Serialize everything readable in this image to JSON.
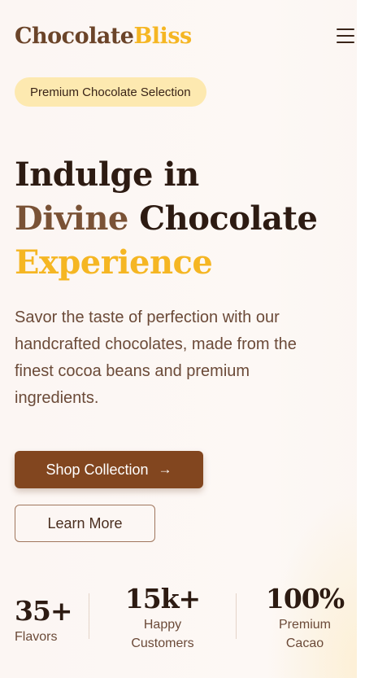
{
  "header": {
    "logo_part1": "Chocolate",
    "logo_part2": "Bliss",
    "menu_icon": "hamburger-menu-icon"
  },
  "hero": {
    "badge": "Premium Chocolate Selection",
    "headline": {
      "line1": "Indulge in",
      "line2_accent": "Divine",
      "line2_rest": " Chocolate",
      "line3": "Experience"
    },
    "description": "Savor the taste of perfection with our handcrafted chocolates, made from the finest cocoa beans and premium ingredients.",
    "primary_cta": "Shop Collection",
    "primary_cta_icon": "arrow-right-icon",
    "secondary_cta": "Learn More"
  },
  "stats": [
    {
      "value": "35+",
      "label": "Flavors"
    },
    {
      "value": "15k+",
      "label_line1": "Happy",
      "label_line2": "Customers"
    },
    {
      "value": "100%",
      "label_line1": "Premium",
      "label_line2": "Cacao"
    }
  ],
  "colors": {
    "brand_brown": "#82461f",
    "brand_gold": "#f5b623",
    "badge_bg": "#fde9b0",
    "text_dark": "#2d1b12"
  }
}
